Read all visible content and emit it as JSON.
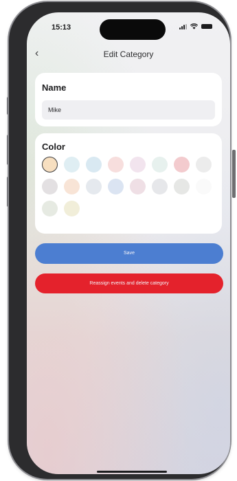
{
  "status_bar": {
    "time": "15:13"
  },
  "nav": {
    "back_icon": "chevron-left-icon",
    "back_glyph": "‹",
    "title": "Edit Category"
  },
  "name_section": {
    "label": "Name",
    "value": "Mike"
  },
  "color_section": {
    "label": "Color",
    "selected_index": 0,
    "swatches": [
      "#f7dfc0",
      "#dfeef3",
      "#d9e9f2",
      "#f7dedd",
      "#f2e4ee",
      "#e7f1ee",
      "#f3cbce",
      "#ececec",
      "#e3e0e2",
      "#f8e4d6",
      "#e5e9ee",
      "#dbe4f2",
      "#efdfe5",
      "#e6e7ea",
      "#e6e7e5",
      "#fafafa",
      "#e6eae2",
      "#f1eed9"
    ]
  },
  "actions": {
    "save_label": "Save",
    "delete_label": "Reassign events and delete category",
    "save_color": "#4c7ed1",
    "delete_color": "#e4222c"
  }
}
